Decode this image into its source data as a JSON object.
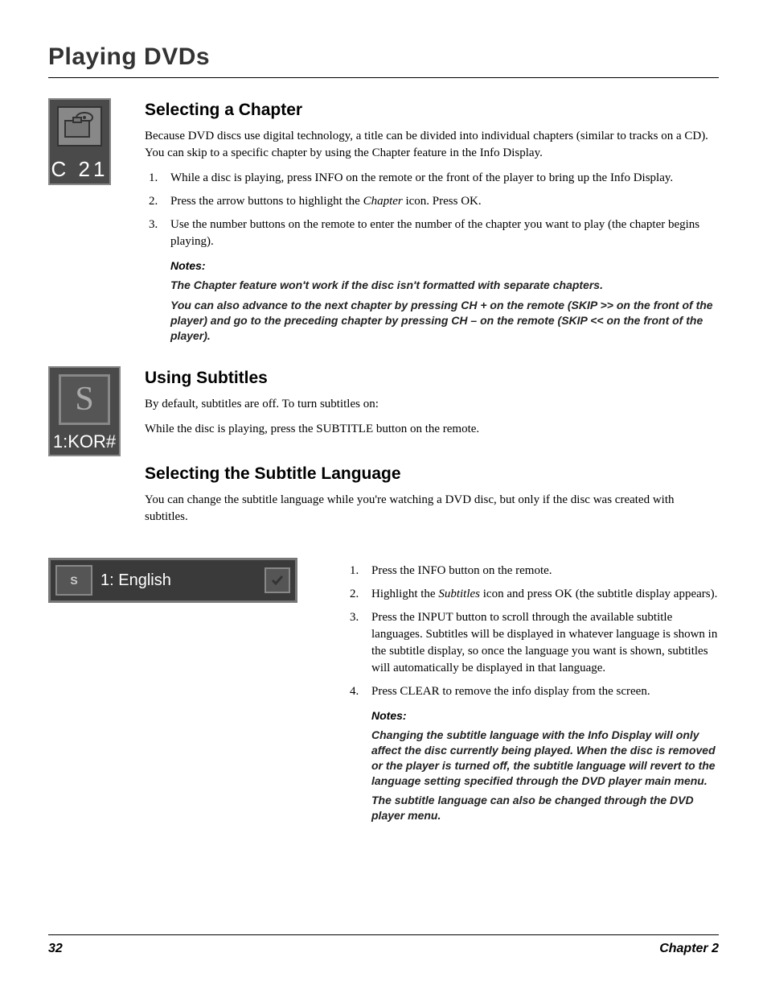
{
  "page_title": "Playing DVDs",
  "chapter_icon": {
    "letter": "C",
    "number": "21"
  },
  "sec1": {
    "heading": "Selecting a Chapter",
    "para": "Because DVD discs use digital technology, a title can be divided into individual chapters (similar to tracks on a CD). You can skip to a specific chapter by using the Chapter feature in the Info Display.",
    "step1": "While a disc is playing, press INFO on the remote or the front of the player to bring up the Info Display.",
    "step2a": "Press the arrow buttons to highlight the ",
    "step2i": "Chapter",
    "step2b": " icon. Press OK.",
    "step3": "Use the number buttons on the remote to enter the number of the chapter you want to play (the chapter begins playing).",
    "notes_label": "Notes:",
    "note1": "The Chapter feature won't work if the disc isn't formatted with separate chapters.",
    "note2": "You can also advance to the next chapter by pressing CH +  on the remote (SKIP >> on the front of the player) and go to the preceding chapter by pressing CH – on the remote (SKIP << on the front of the player)."
  },
  "subtitle_icon": {
    "letter": "S",
    "label": "1:KOR#"
  },
  "sec2": {
    "heading": "Using Subtitles",
    "para1": "By default, subtitles are off. To turn subtitles on:",
    "para2": "While the disc is playing, press the SUBTITLE button on the remote."
  },
  "sec3": {
    "heading": "Selecting the Subtitle Language",
    "para": "You can change the subtitle language while you're watching a DVD disc, but only if the disc was created with subtitles.",
    "bar_icon_letter": "S",
    "bar_text": "1: English",
    "step1": "Press the INFO button on the remote.",
    "step2a": "Highlight the ",
    "step2i": "Subtitles",
    "step2b": " icon and press OK (the subtitle display appears).",
    "step3": "Press the INPUT button to scroll through the available subtitle languages. Subtitles will be displayed in whatever language is shown in the subtitle display, so once the language you want is shown, subtitles will automatically be displayed in that language.",
    "step4": "Press CLEAR to remove the info display from the screen.",
    "notes_label": "Notes:",
    "note1": "Changing the subtitle language with the Info Display will only affect the disc currently being played. When the disc is removed or the player is turned off, the subtitle language will revert to the language setting specified through the DVD player main menu.",
    "note2": "The subtitle language can also be changed through the DVD player menu."
  },
  "footer": {
    "page": "32",
    "chapter": "Chapter 2"
  }
}
